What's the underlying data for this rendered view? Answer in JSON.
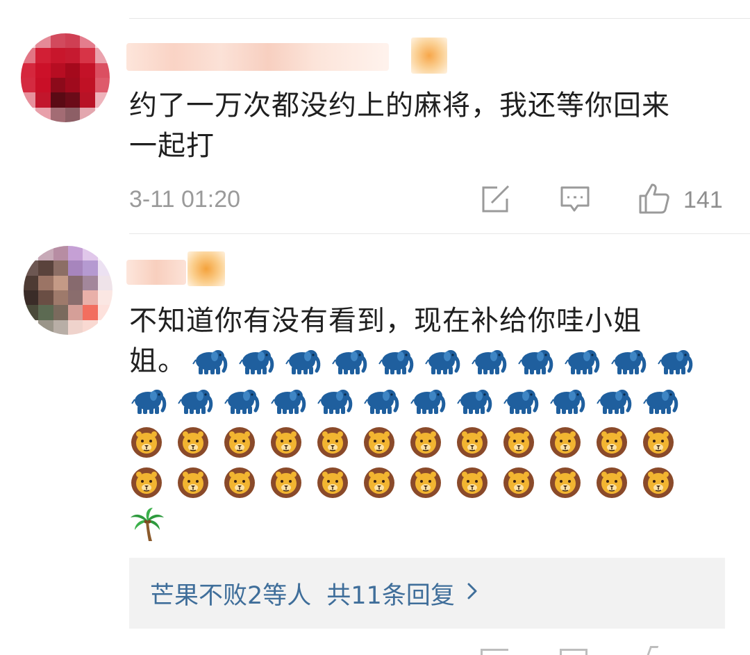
{
  "comments": [
    {
      "text_line1": "约了一万次都没约上的麻将，我还等你回来",
      "text_line2": "一起打",
      "timestamp": "3-11 01:20",
      "like_count": "141",
      "icons": [
        "share-icon",
        "comment-icon",
        "thumbs-up-icon"
      ]
    },
    {
      "text_line1": "不知道你有没有看到，现在补给你哇小姐",
      "text_line2_prefix": "姐。",
      "emoji": {
        "elephant": "elephant-emoji",
        "lion": "lion-emoji",
        "palm": "palm-tree-emoji"
      },
      "replies": {
        "repliers": "芒果不败2等人",
        "total": "共11条回复",
        "chevron": "›"
      }
    }
  ],
  "colors": {
    "link_blue": "#3f6e9a",
    "meta_gray": "#9a9a9a",
    "reply_bg": "#f2f2f2",
    "elephant_blue": "#1f5f9e",
    "lion_mane": "#8a4a2a",
    "lion_face": "#f2b531"
  }
}
